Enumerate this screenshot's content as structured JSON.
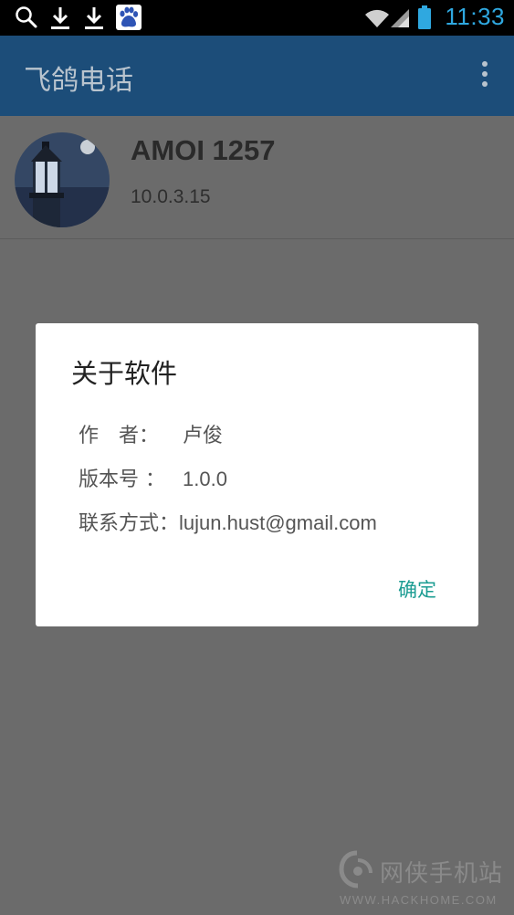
{
  "status_bar": {
    "time": "11:33",
    "icons": [
      "search-icon",
      "download-icon",
      "download-icon",
      "baidu-icon",
      "wifi-icon",
      "signal-icon",
      "battery-icon"
    ]
  },
  "app_bar": {
    "title": "飞鸽电话",
    "menu_icon": "overflow-menu-icon"
  },
  "device": {
    "name": "AMOI 1257",
    "version": "10.0.3.15"
  },
  "dialog": {
    "title": "关于软件",
    "rows": [
      {
        "label": "作　者：",
        "value": "卢俊"
      },
      {
        "label": "版本号 ：",
        "value": "1.0.0"
      },
      {
        "label": "联系方式：",
        "value": "lujun.hust@gmail.com"
      }
    ],
    "ok_label": "确定"
  },
  "watermark": {
    "text": "网侠手机站",
    "url": "WWW.HACKHOME.COM"
  },
  "colors": {
    "app_bar": "#1c4d79",
    "accent": "#1b9c92",
    "time": "#2fa8e0",
    "scrim": "#6b6b6b"
  }
}
